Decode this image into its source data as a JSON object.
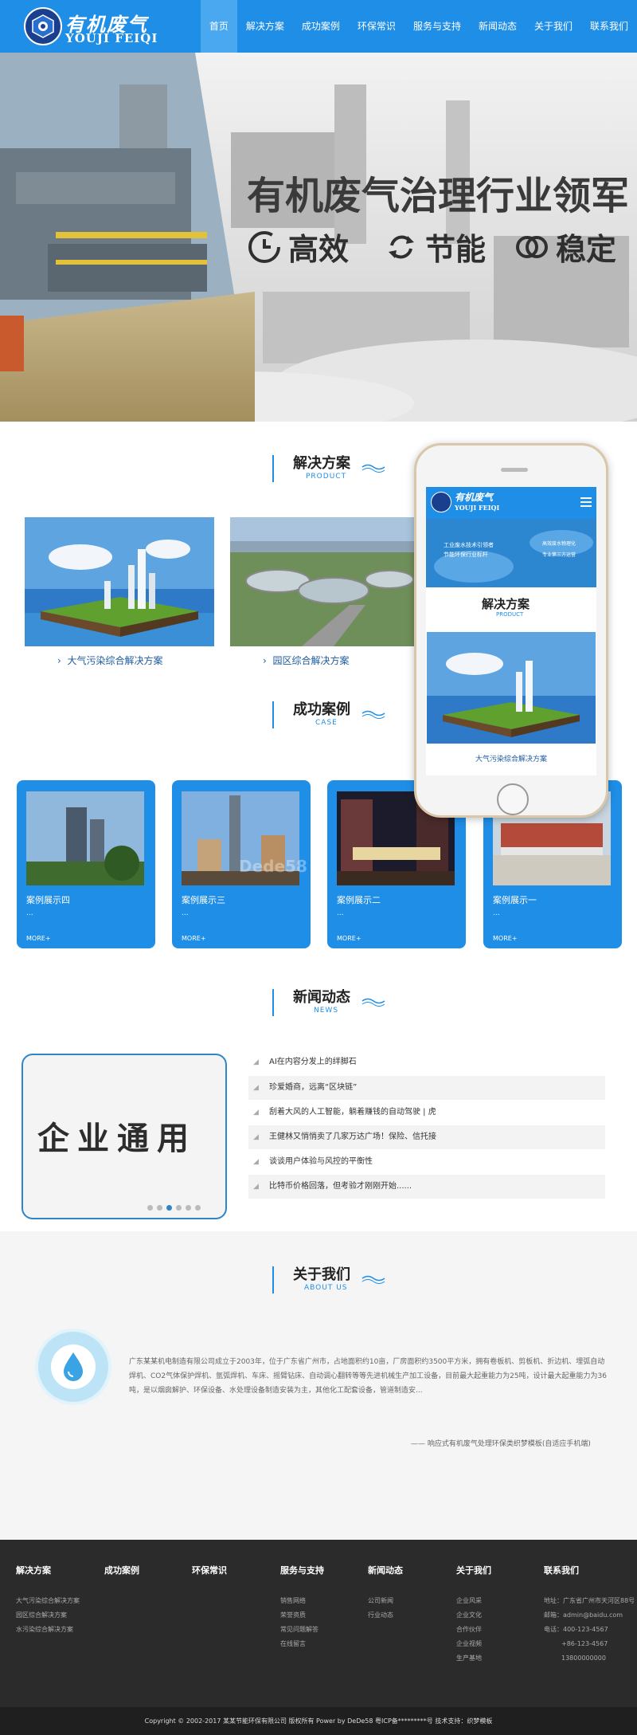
{
  "header": {
    "logo_cn": "有机废气",
    "logo_en": "YOUJI FEIQI",
    "nav": [
      "首页",
      "解决方案",
      "成功案例",
      "环保常识",
      "服务与支持",
      "新闻动态",
      "关于我们",
      "联系我们"
    ]
  },
  "banner": {
    "title": "有机废气治理行业领军",
    "features": [
      "高效",
      "节能",
      "稳定"
    ]
  },
  "solutions": {
    "title_cn": "解决方案",
    "title_en": "PRODUCT",
    "items": [
      "大气污染综合解决方案",
      "园区综合解决方案"
    ]
  },
  "phone": {
    "logo_cn": "有机废气",
    "logo_en": "YOUJI FEIQI",
    "banner_text1": "工业废水技术引领者",
    "banner_text2": "节能环保行业标杆",
    "banner_text3": "高效废水物理化",
    "banner_text4": "专业第三方运营",
    "section_cn": "解决方案",
    "section_en": "PRODUCT",
    "caption": "大气污染综合解决方案"
  },
  "cases": {
    "title_cn": "成功案例",
    "title_en": "CASE",
    "more": "MORE+",
    "dot": "...",
    "items": [
      "案例展示四",
      "案例展示三",
      "案例展示二",
      "案例展示一"
    ],
    "watermark": "Dede58"
  },
  "news": {
    "title_cn": "新闻动态",
    "title_en": "NEWS",
    "image_text": "企业通用",
    "items": [
      "AI在内容分发上的绊脚石",
      "珍爱婚商，远离“区块链”",
      "刮着大风的人工智能，躺着赚钱的自动驾驶 | 虎",
      "王健林又悄悄卖了几家万达广场！保险、信托接",
      "谈谈用户体验与风控的平衡性",
      "比特币价格回落，但考验才刚刚开始......"
    ]
  },
  "about": {
    "title_cn": "关于我们",
    "title_en": "ABOUT US",
    "text": "广东某某机电制造有限公司成立于2003年，位于广东省广州市，占地面积约10亩，厂房面积约3500平方米，拥有卷板机、剪板机、折边机、埋弧自动焊机、CO2气体保护焊机、氩弧焊机、车床、摇臂钻床、自动调心翻转等等先进机械生产加工设备，目前最大起重能力为25吨，设计最大起重能力为36吨，是以烟囱解护、环保设备、水处理设备制造安装为主，其他化工配套设备，管道制造安...",
    "link": "—— 响应式有机废气处理环保类织梦模板(自适应手机端)"
  },
  "footer": {
    "columns": [
      {
        "title": "解决方案",
        "items": [
          "大气污染综合解决方案",
          "园区综合解决方案",
          "水污染综合解决方案"
        ]
      },
      {
        "title": "成功案例",
        "items": []
      },
      {
        "title": "环保常识",
        "items": []
      },
      {
        "title": "服务与支持",
        "items": [
          "销售网络",
          "荣誉资质",
          "常见问题解答",
          "在线留言"
        ]
      },
      {
        "title": "新闻动态",
        "items": [
          "公司新闻",
          "行业动态"
        ]
      },
      {
        "title": "关于我们",
        "items": [
          "企业风采",
          "企业文化",
          "合作伙伴",
          "企业视频",
          "生产基地"
        ]
      },
      {
        "title": "联系我们",
        "items": [
          "地址：广东省广州市天河区88号",
          "邮箱：admin@baidu.com",
          "电话：400-123-4567",
          "+86-123-4567",
          "13800000000"
        ]
      }
    ],
    "copyright": "Copyright © 2002-2017 某某节能环保有限公司 版权所有   Power by DeDe58   粤ICP备*********号   技术支持：织梦模板"
  }
}
